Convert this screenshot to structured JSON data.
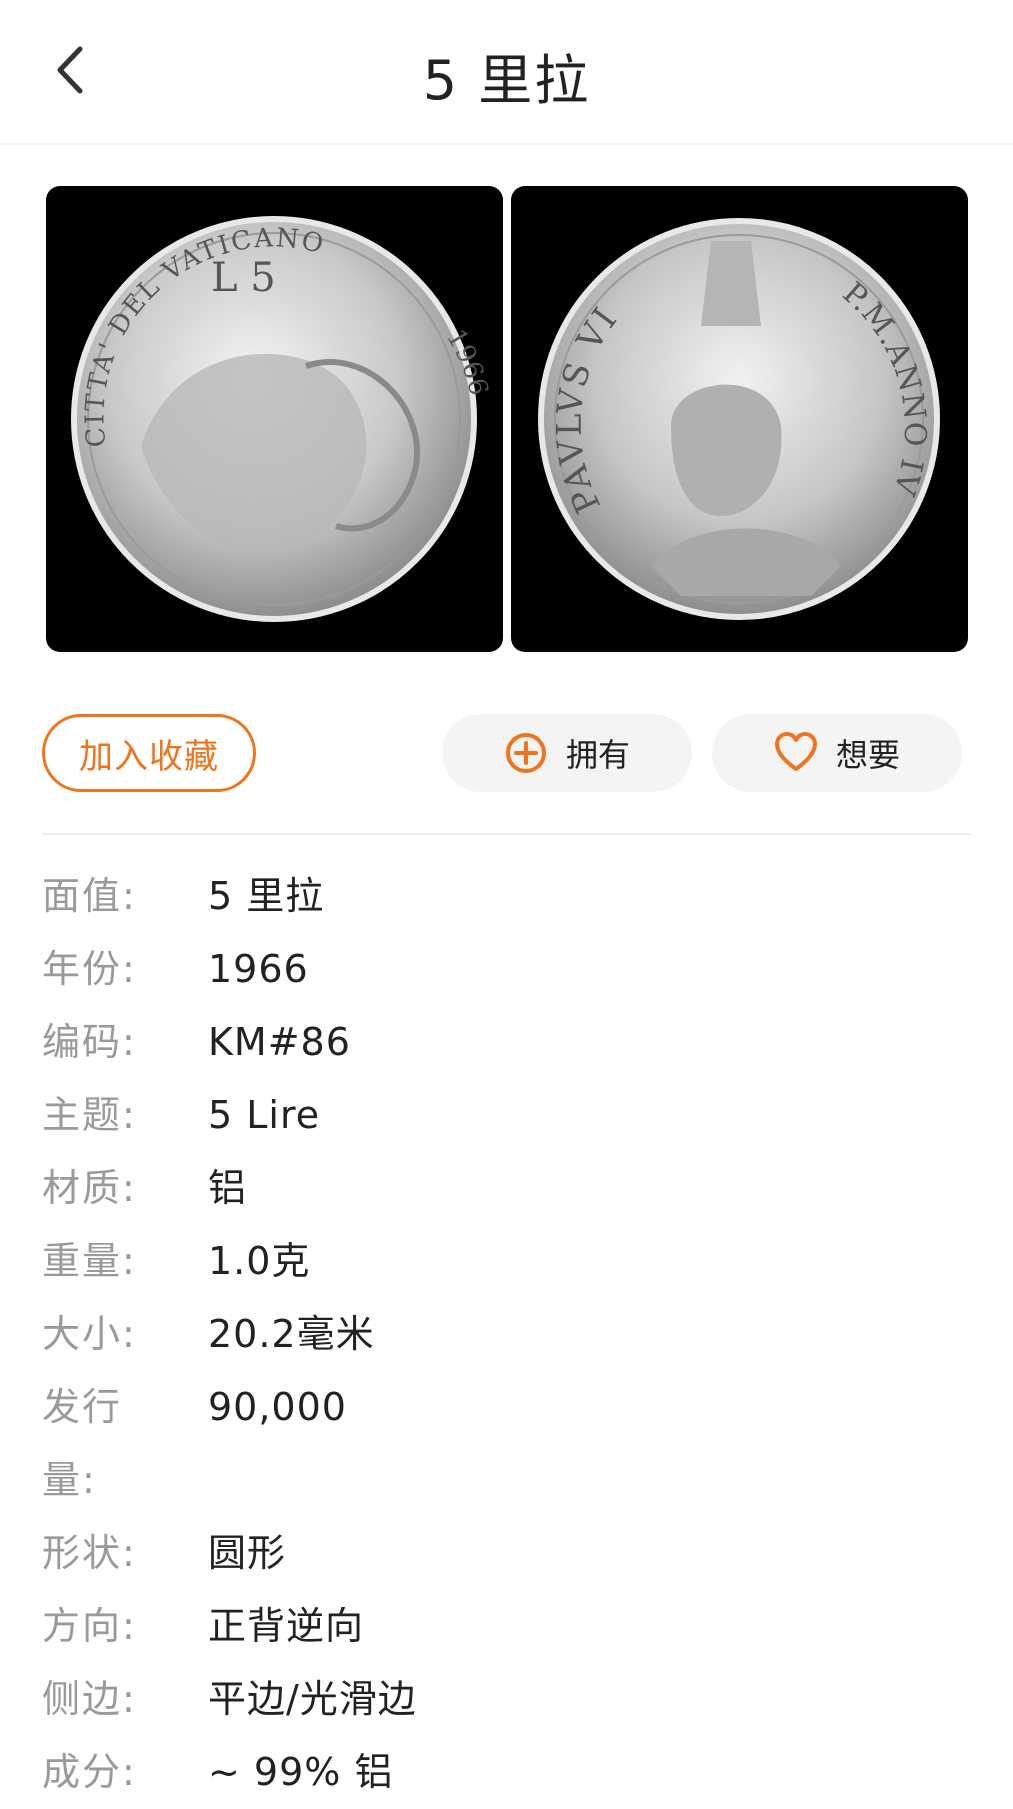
{
  "header": {
    "title": "5 里拉",
    "back_icon": "chevron-left-icon"
  },
  "images": {
    "obverse_legend_top": "CITTA' DEL VATICANO",
    "obverse_denomination": "L 5",
    "obverse_year": "1966",
    "reverse_legend_left": "PAVLVS VI",
    "reverse_legend_right": "P.M.ANNO IV"
  },
  "actions": {
    "favorite_label": "加入收藏",
    "own_label": "拥有",
    "own_icon": "plus-circle-icon",
    "want_label": "想要",
    "want_icon": "heart-icon",
    "accent_color": "#f0741c"
  },
  "details": [
    {
      "label": "面值:",
      "value": "5 里拉"
    },
    {
      "label": "年份:",
      "value": "1966"
    },
    {
      "label": "编码:",
      "value": "KM#86"
    },
    {
      "label": "主题:",
      "value": "5 Lire"
    },
    {
      "label": "材质:",
      "value": "铝"
    },
    {
      "label": "重量:",
      "value": "1.0克"
    },
    {
      "label": "大小:",
      "value": "20.2毫米"
    },
    {
      "label": "发行量:",
      "value": "90,000"
    },
    {
      "label": "形状:",
      "value": "圆形"
    },
    {
      "label": "方向:",
      "value": "正背逆向"
    },
    {
      "label": "侧边:",
      "value": "平边/光滑边"
    },
    {
      "label": "成分:",
      "value": "~ 99% 铝"
    }
  ]
}
